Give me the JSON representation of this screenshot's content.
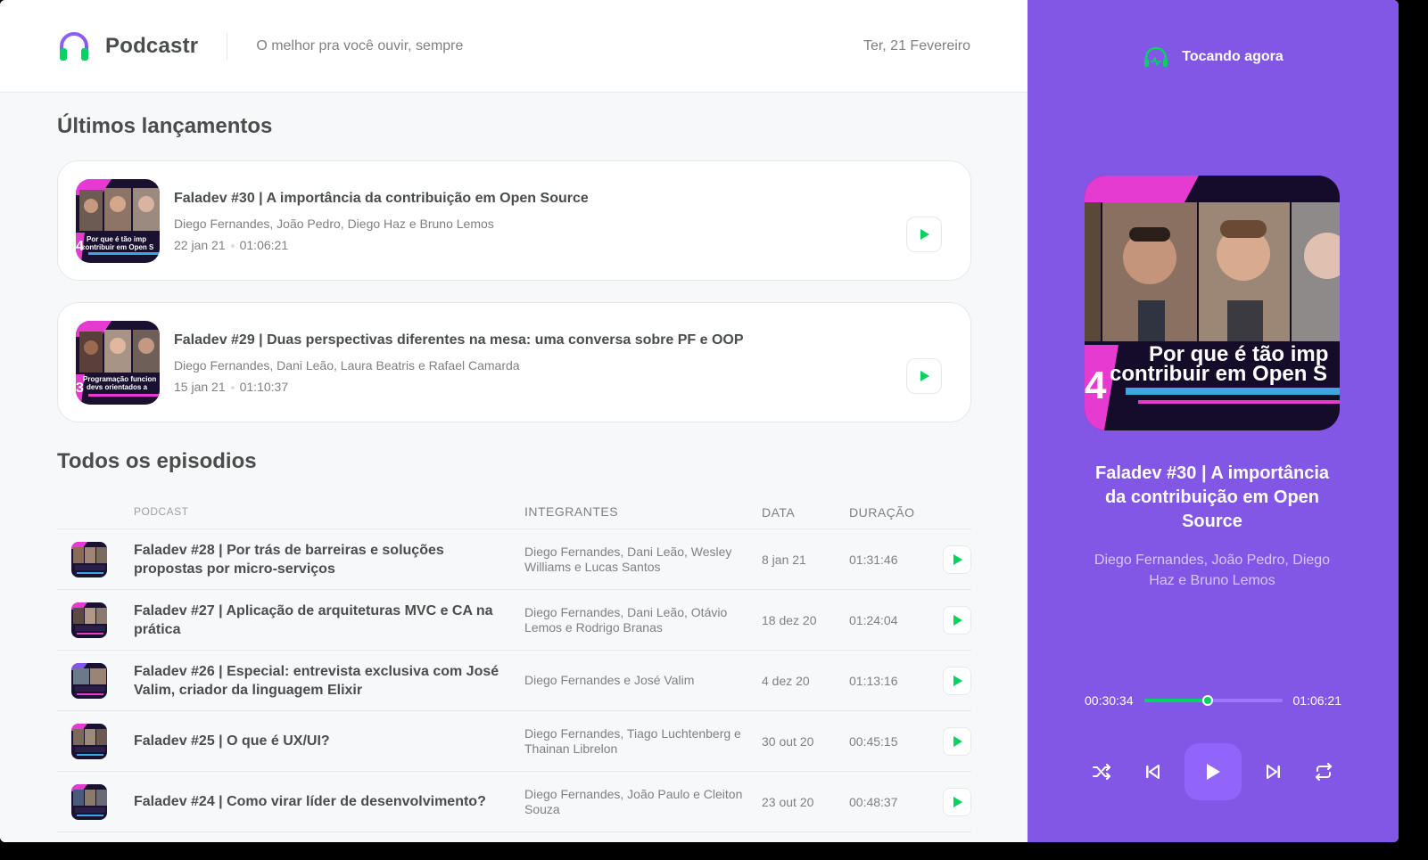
{
  "header": {
    "app_name": "Podcastr",
    "tagline": "O melhor pra você ouvir, sempre",
    "date": "Ter, 21 Fevereiro"
  },
  "latest": {
    "title": "Últimos lançamentos",
    "episodes": [
      {
        "title": "Faladev #30 | A importância da contribuição em Open Source",
        "members": "Diego Fernandes, João Pedro, Diego Haz e Bruno Lemos",
        "date": "22 jan 21",
        "duration": "01:06:21",
        "thumb_text": "Por que é tão imp contribuir em Open S"
      },
      {
        "title": "Faladev #29 | Duas perspectivas diferentes na mesa: uma conversa sobre PF e OOP",
        "members": "Diego Fernandes, Dani Leão, Laura Beatris e Rafael Camarda",
        "date": "15 jan 21",
        "duration": "01:10:37",
        "thumb_text": "Programação funcion devs orientados a"
      }
    ]
  },
  "all": {
    "title": "Todos os episodios",
    "columns": {
      "podcast": "Podcast",
      "members": "Integrantes",
      "date": "Data",
      "duration": "Duração"
    },
    "rows": [
      {
        "title": "Faladev #28 | Por trás de barreiras e soluções propostas por micro-serviços",
        "members": "Diego Fernandes, Dani Leão, Wesley Williams e Lucas Santos",
        "date": "8 jan 21",
        "duration": "01:31:46"
      },
      {
        "title": "Faladev #27 | Aplicação de arquiteturas MVC e CA na prática",
        "members": "Diego Fernandes, Dani Leão, Otávio Lemos e Rodrigo Branas",
        "date": "18 dez 20",
        "duration": "01:24:04"
      },
      {
        "title": "Faladev #26 | Especial: entrevista exclusiva com José Valim, criador da linguagem Elixir",
        "members": "Diego Fernandes e José Valim",
        "date": "4 dez 20",
        "duration": "01:13:16"
      },
      {
        "title": "Faladev #25 | O que é UX/UI?",
        "members": "Diego Fernandes, Tiago Luchtenberg e Thainan Librelon",
        "date": "30 out 20",
        "duration": "00:45:15"
      },
      {
        "title": "Faladev #24 | Como virar líder de desenvolvimento?",
        "members": "Diego Fernandes, João Paulo e Cleiton Souza",
        "date": "23 out 20",
        "duration": "00:48:37"
      }
    ]
  },
  "player": {
    "heading": "Tocando agora",
    "title": "Faladev #30 | A importância da contribuição em Open Source",
    "members": "Diego Fernandes, João Pedro, Diego Haz e Bruno Lemos",
    "elapsed": "00:30:34",
    "total": "01:06:21",
    "progress_fraction": 0.46,
    "cover_text_line1": "Por que é tão imp",
    "cover_text_line2": "contribuir em Open S",
    "cover_number": "4"
  },
  "colors": {
    "purple": "#8257e5",
    "green": "#04d361",
    "magenta": "#e63bd0"
  },
  "icons": [
    "headphones-icon",
    "play-icon",
    "shuffle-icon",
    "previous-icon",
    "next-icon",
    "repeat-icon"
  ]
}
